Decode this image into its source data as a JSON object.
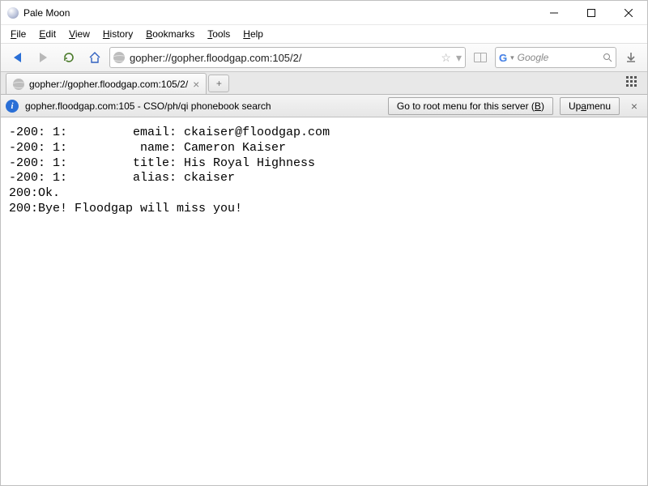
{
  "window": {
    "title": "Pale Moon"
  },
  "menu": [
    "File",
    "Edit",
    "View",
    "History",
    "Bookmarks",
    "Tools",
    "Help"
  ],
  "nav": {
    "url": "gopher://gopher.floodgap.com:105/2/",
    "search_engine_letter": "G",
    "search_separator": "▾",
    "search_placeholder": "Google"
  },
  "tab": {
    "title": "gopher://gopher.floodgap.com:105/2/",
    "newtab_symbol": "+"
  },
  "infobar": {
    "text": "gopher.floodgap.com:105 - CSO/ph/qi phonebook search",
    "button_root_pre": "Go to root menu for this server (",
    "button_root_key": "B",
    "button_root_post": ")",
    "button_up_pre": "Up ",
    "button_up_key": "a",
    "button_up_post": " menu"
  },
  "body_text": "-200: 1:         email: ckaiser@floodgap.com\n-200: 1:          name: Cameron Kaiser\n-200: 1:         title: His Royal Highness\n-200: 1:         alias: ckaiser\n200:Ok.\n200:Bye! Floodgap will miss you!"
}
